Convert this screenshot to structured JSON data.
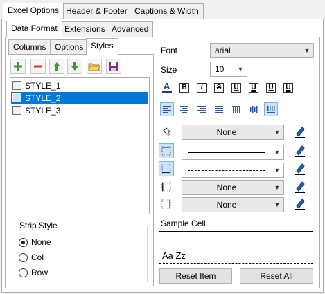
{
  "top_tabs": [
    "Excel Options",
    "Header & Footer",
    "Captions & Width"
  ],
  "sub_tabs": [
    "Data Format",
    "Extensions",
    "Advanced"
  ],
  "inner_tabs": [
    "Columns",
    "Options",
    "Styles"
  ],
  "styles_list": [
    "STYLE_1",
    "STYLE_2",
    "STYLE_3"
  ],
  "selected_style": "STYLE_2",
  "strip_style": {
    "title": "Strip Style",
    "options": [
      "None",
      "Col",
      "Row"
    ],
    "selected": "None"
  },
  "font": {
    "label": "Font",
    "value": "arial"
  },
  "size": {
    "label": "Size",
    "value": "10"
  },
  "format_buttons": [
    "B",
    "I",
    "S",
    "U",
    "U",
    "U",
    "U"
  ],
  "fill_combo": "None",
  "borders": {
    "line1": "solid",
    "line2": "dashed",
    "line3": "None",
    "line4": "None"
  },
  "sample": {
    "title": "Sample Cell",
    "text": "Aa Zz"
  },
  "buttons": {
    "reset_item": "Reset Item",
    "reset_all": "Reset All"
  },
  "colors": {
    "accent": "#0078d7",
    "toggle_on": "#cce4f7",
    "green": "#3a9b3a",
    "red": "#d9342b"
  },
  "icons": [
    "add-icon",
    "remove-icon",
    "move-up-icon",
    "move-down-icon",
    "open-folder-icon",
    "save-icon",
    "font-color-icon",
    "fill-bucket-icon",
    "pencil-icon",
    "align-left-icon",
    "align-center-icon",
    "align-right-icon",
    "justify-icon"
  ]
}
